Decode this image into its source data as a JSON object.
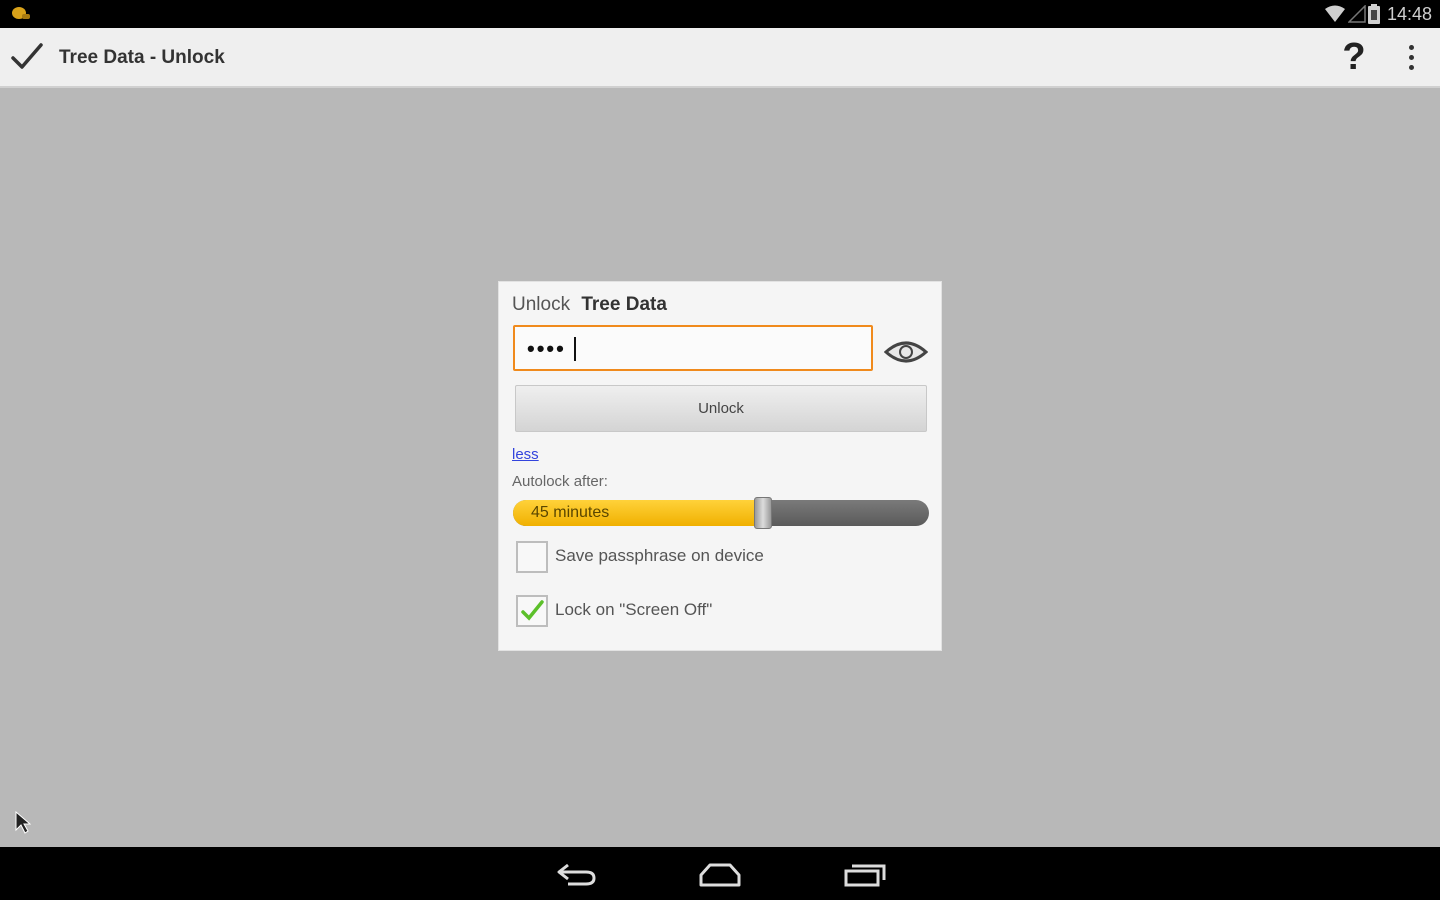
{
  "status_bar": {
    "time": "14:48",
    "icons": [
      "app-notification-icon",
      "wifi-icon",
      "signal-icon",
      "battery-icon"
    ]
  },
  "action_bar": {
    "title": "Tree Data - Unlock",
    "done_icon": "checkmark-icon",
    "help_label": "?",
    "overflow_icon": "overflow-menu-icon"
  },
  "dialog": {
    "title_prefix": "Unlock",
    "title_name": "Tree Data",
    "passphrase_masked": "••••",
    "reveal_icon": "eye-icon",
    "unlock_label": "Unlock",
    "less_link": "less",
    "autolock_label": "Autolock after:",
    "autolock_value_label": "45 minutes",
    "autolock_fraction": 0.6,
    "save_passphrase": {
      "label": "Save passphrase on device",
      "checked": false
    },
    "lock_screen_off": {
      "label": "Lock on \"Screen Off\"",
      "checked": true
    }
  },
  "nav_bar": {
    "icons": [
      "back-icon",
      "home-icon",
      "recent-apps-icon"
    ]
  },
  "colors": {
    "accent_orange": "#f08a1c",
    "slider_yellow": "#f5c000",
    "check_green": "#5cc02a",
    "background": "#b8b8b8"
  }
}
